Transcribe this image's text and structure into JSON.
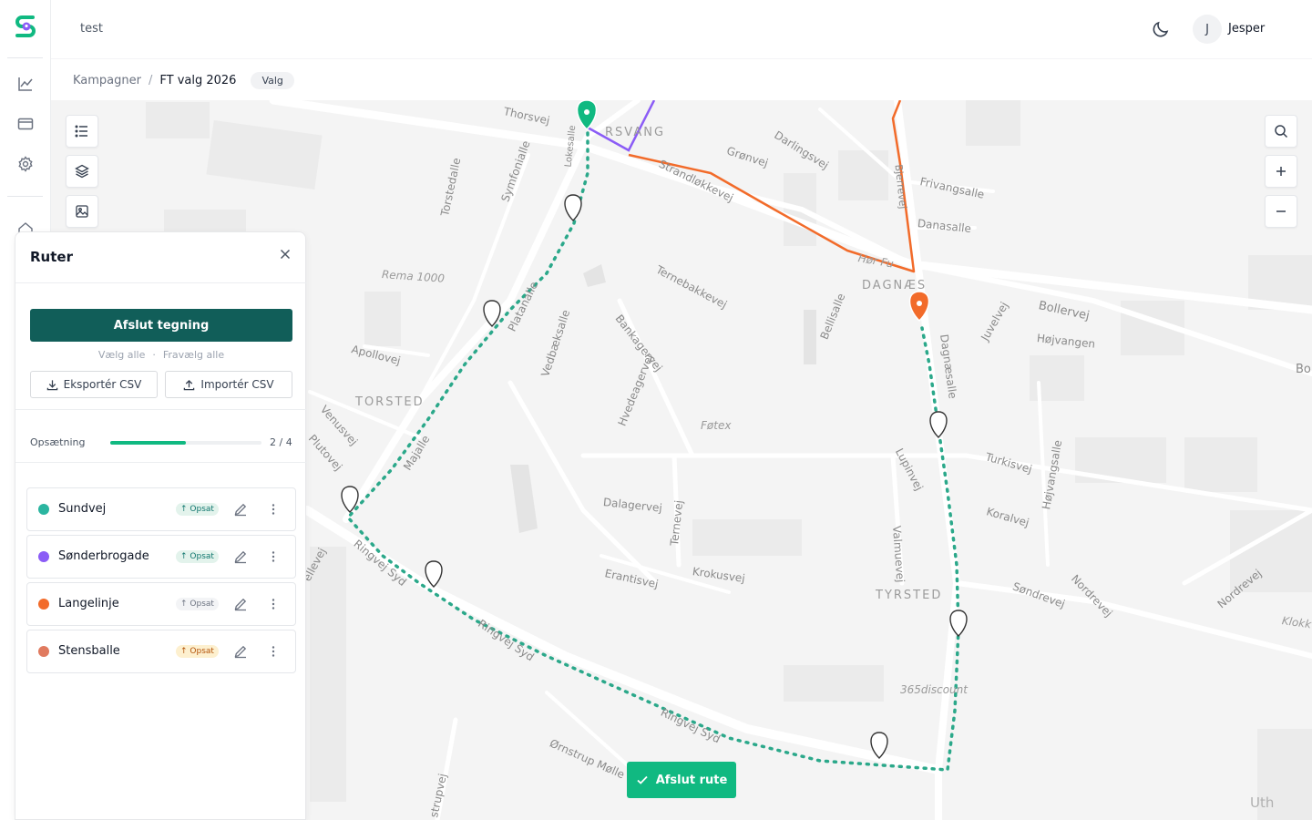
{
  "workspace": {
    "name": "test"
  },
  "user": {
    "initial": "J",
    "name": "Jesper"
  },
  "breadcrumb": {
    "parent": "Kampagner",
    "separator": "/",
    "current": "FT valg 2026",
    "badge": "Valg"
  },
  "panel": {
    "title": "Ruter",
    "finish_drawing": "Afslut tegning",
    "select_all": "Vælg alle",
    "select_sep": "·",
    "deselect_all": "Fravælg alle",
    "export_csv": "Eksportér CSV",
    "import_csv": "Importér CSV",
    "setup_label": "Opsætning",
    "setup_count": "2 / 4",
    "setup_progress": 0.5,
    "routes": [
      {
        "name": "Sundvej",
        "color": "#2bb5a0",
        "status": "↑ Opsat",
        "status_bg": "#e3f3ec",
        "status_fg": "#0f766e"
      },
      {
        "name": "Sønderbrogade",
        "color": "#8b5cf6",
        "status": "↑ Opsat",
        "status_bg": "#e3f3ec",
        "status_fg": "#0f766e"
      },
      {
        "name": "Langelinje",
        "color": "#f26b2a",
        "status": "↑ Opsat",
        "status_bg": "#f3f4f6",
        "status_fg": "#6b7280"
      },
      {
        "name": "Stensballe",
        "color": "#e07a5f",
        "status": "↑ Opsat",
        "status_bg": "#fdf0cf",
        "status_fg": "#b45309"
      }
    ]
  },
  "map": {
    "finish_route": "Afslut rute",
    "labels": {
      "thorsvej": "Thorsvej",
      "rsvang": "RSVANG",
      "gronvej": "Grønvej",
      "darlingsvej": "Darlingsvej",
      "frivangsalle": "Frivangsalle",
      "danasalle": "Danasalle",
      "strandlokkevej": "Strandløkkevej",
      "ternebakkevej": "Ternebakkevej",
      "dagnaes": "DAGNÆS",
      "bollervej": "Bollervej",
      "hojvangen": "Højvangen",
      "rema": "Rema 1000",
      "apollovej": "Apollovej",
      "torsted": "TORSTED",
      "venusvej": "Venusvej",
      "plutovej": "Plutovej",
      "majalle": "Majalle",
      "bankagervej": "Bankagervej",
      "hvedeagervej": "Hvedeagervej",
      "fotex": "Føtex",
      "bellisalle": "Bellisalle",
      "dagnaesalle": "Dagnæsalle",
      "juvelvej": "Juvelvej",
      "lupinvej": "Lupinvej",
      "turkisvej": "Turkisvej",
      "hojvangsalle": "Højvangsalle",
      "koralvej": "Koralvej",
      "dalagervej": "Dalagervej",
      "ternevej": "Ternevej",
      "krokusvej": "Krokusvej",
      "erantisvej": "Erantisvej",
      "valmuevej": "Valmuevej",
      "tyrsted": "TYRSTED",
      "sondrevej": "Søndrevej",
      "nordrevej": "Nordrevej",
      "nordrevej2": "Nordrevej",
      "klok": "Klokk",
      "ringvej1": "Ringvej Syd",
      "ringvej2": "Ringvej Syd",
      "ringvej3": "Ringvej Syd",
      "discount": "365discount",
      "ornstrup": "Ørnstrup Mølle",
      "strupvej": "strupvej",
      "torstedalle": "Torstedalle",
      "symfonialle": "Symfonialle",
      "platanalle": "Platanalle",
      "vedbaeksalle": "Vedbæksalle",
      "lokesalle": "Lokesalle",
      "uth": "Uth",
      "bo": "Bo",
      "ellevej": "ellevej",
      "horfu": "Hør Fu",
      "bjerrev": "Bjerrevej"
    }
  }
}
